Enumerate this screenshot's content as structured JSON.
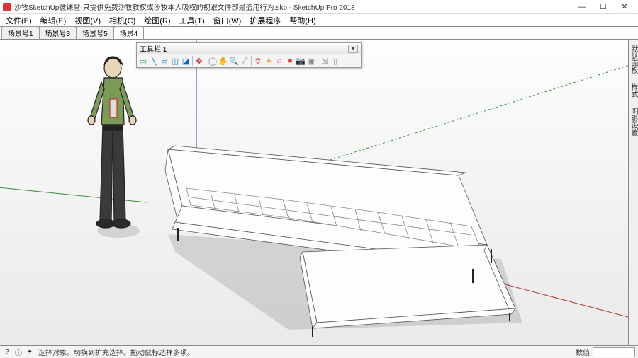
{
  "window": {
    "title": "沙牧SketchUp微课堂-只提供免费沙牧教权或沙牧本人吸权的视跟文件部是盗用行为.skp - SketchUp Pro 2018",
    "min": "—",
    "max": "☐",
    "close": "✕"
  },
  "menu": {
    "items": [
      "文件(E)",
      "编辑(E)",
      "视图(V)",
      "相机(C)",
      "绘图(R)",
      "工具(T)",
      "窗口(W)",
      "扩展程序",
      "帮助(H)"
    ]
  },
  "scenes": {
    "tabs": [
      "场景号1",
      "场景号3",
      "场景号5",
      "场景4"
    ]
  },
  "toolbar": {
    "title": "工具栏 1",
    "close": "x",
    "icons": [
      {
        "name": "select-icon",
        "glyph": "▭",
        "color": "#2a6"
      },
      {
        "name": "line-icon",
        "glyph": "╲",
        "color": "#06c"
      },
      {
        "name": "rect-icon",
        "glyph": "▱",
        "color": "#06c"
      },
      {
        "name": "shape-icon",
        "glyph": "◫",
        "color": "#06c"
      },
      {
        "name": "pushpull-icon",
        "glyph": "◪",
        "color": "#06c"
      },
      {
        "name": "sep"
      },
      {
        "name": "move-icon",
        "glyph": "✥",
        "color": "#c33"
      },
      {
        "name": "sep"
      },
      {
        "name": "orbit-icon",
        "glyph": "◯",
        "color": "#888"
      },
      {
        "name": "pan-icon",
        "glyph": "✋",
        "color": "#888"
      },
      {
        "name": "zoom-icon",
        "glyph": "🔍",
        "color": "#888"
      },
      {
        "name": "zoomext-icon",
        "glyph": "⤢",
        "color": "#888"
      },
      {
        "name": "sep"
      },
      {
        "name": "gear-icon",
        "glyph": "✲",
        "color": "#d55"
      },
      {
        "name": "sun-icon",
        "glyph": "☀",
        "color": "#e80"
      },
      {
        "name": "camera-icon",
        "glyph": "⌂",
        "color": "#d33"
      },
      {
        "name": "record-icon",
        "glyph": "■",
        "color": "#d33"
      },
      {
        "name": "snapshot-icon",
        "glyph": "📷",
        "color": "#d33"
      },
      {
        "name": "folder-icon",
        "glyph": "▣",
        "color": "#888"
      },
      {
        "name": "sep"
      },
      {
        "name": "export-icon",
        "glyph": "⇲",
        "color": "#888"
      },
      {
        "name": "doc-icon",
        "glyph": "▯",
        "color": "#888"
      }
    ]
  },
  "tray": {
    "labels": [
      "默认面板",
      "样式",
      "阴影设置"
    ]
  },
  "status": {
    "help_icon": "?",
    "info_icon": "ⓘ",
    "pin_icon": "✦",
    "text": "选择对象。切换到扩充选择。拖动鼠标选择多项。",
    "measure_label": "数值",
    "measure_value": ""
  }
}
